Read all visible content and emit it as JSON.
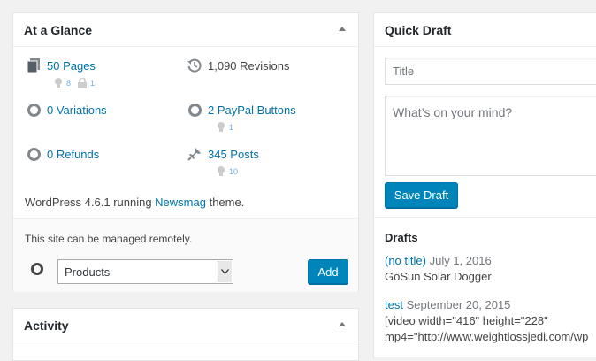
{
  "glance": {
    "title": "At a Glance",
    "pages": {
      "label": "50 Pages",
      "sub_hint_count": "8",
      "sub_lock_count": "1"
    },
    "revisions": {
      "label": "1,090 Revisions"
    },
    "variations": {
      "label": "0 Variations"
    },
    "paypal": {
      "label": "2 PayPal Buttons",
      "sub_hint_count": "1"
    },
    "refunds": {
      "label": "0 Refunds"
    },
    "posts": {
      "label": "345 Posts",
      "sub_hint_count": "10"
    },
    "wp_prefix": "WordPress 4.6.1 running ",
    "theme_link": "Newsmag",
    "wp_suffix": " theme.",
    "remote_text": "This site can be managed remotely.",
    "select_value": "Products",
    "add_label": "Add"
  },
  "activity": {
    "title": "Activity"
  },
  "quick_draft": {
    "title": "Quick Draft",
    "title_placeholder": "Title",
    "content_placeholder": "What’s on your mind?",
    "save_label": "Save Draft",
    "drafts_heading": "Drafts",
    "drafts": [
      {
        "title": "(no title)",
        "date": "July 1, 2016",
        "excerpt": "GoSun Solar Dogger"
      },
      {
        "title": "test",
        "date": "September 20, 2015",
        "excerpt_line1": "[video width=\"416\" height=\"228\"",
        "excerpt_line2": "mp4=\"http://www.weightlossjedi.com/wp"
      }
    ]
  },
  "icons": [
    "pages-icon",
    "revisions-icon",
    "variations-icon",
    "paypal-icon",
    "refunds-icon",
    "posts-icon",
    "lightbulb-icon",
    "lock-icon",
    "plugin-ring-icon",
    "collapse-arrow-icon"
  ]
}
